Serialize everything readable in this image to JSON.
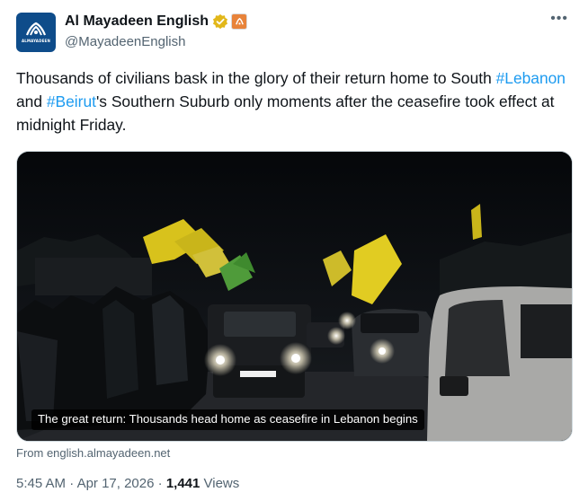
{
  "account": {
    "display_name": "Al Mayadeen English",
    "handle": "@MayadeenEnglish",
    "avatar_text": "ALMAYADEEN",
    "verified_icon": "verified-gold-badge-icon",
    "affiliate_icon": "affiliate-logo-icon"
  },
  "tweet": {
    "text_part1": "Thousands of civilians bask in the glory of their return home to South ",
    "hashtag1": "#Lebanon",
    "text_part2": " and ",
    "hashtag2": "#Beirut",
    "text_part3": "'s Southern Suburb only moments after the ceasefire took effect at midnight Friday."
  },
  "media": {
    "caption": "The great return: Thousands head home as ceasefire in Lebanon begins",
    "source": "From english.almayadeen.net"
  },
  "meta": {
    "time": "5:45 AM",
    "separator": " · ",
    "date": "Apr 17, 2026",
    "views_count": "1,441",
    "views_label": " Views"
  },
  "menu": {
    "more_label": "•••"
  },
  "colors": {
    "link": "#1d9bf0",
    "secondary_text": "#536471",
    "verified": "#e2b719",
    "avatar_bg": "#0e4c8a"
  }
}
